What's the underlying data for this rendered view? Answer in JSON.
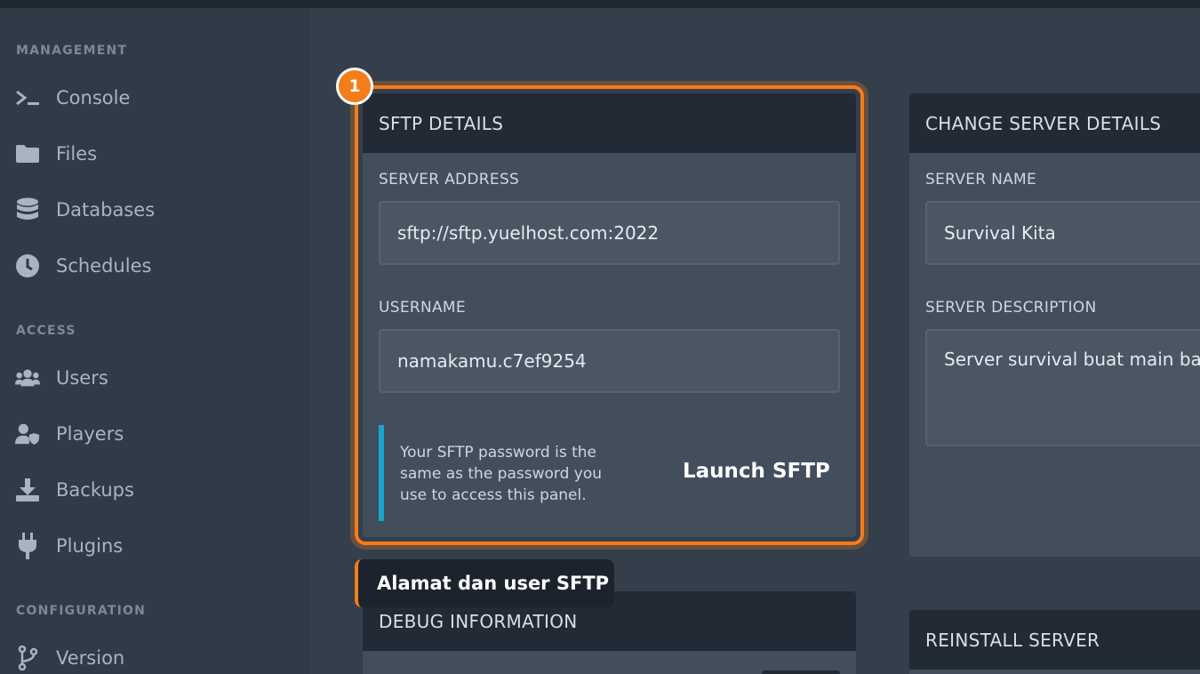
{
  "sidebar": {
    "sections": [
      {
        "label": "MANAGEMENT"
      },
      {
        "label": "ACCESS"
      },
      {
        "label": "CONFIGURATION"
      }
    ],
    "items": [
      {
        "label": "Console",
        "icon": "terminal-icon"
      },
      {
        "label": "Files",
        "icon": "folder-icon"
      },
      {
        "label": "Databases",
        "icon": "database-icon"
      },
      {
        "label": "Schedules",
        "icon": "clock-icon"
      },
      {
        "label": "Users",
        "icon": "users-icon"
      },
      {
        "label": "Players",
        "icon": "user-shield-icon"
      },
      {
        "label": "Backups",
        "icon": "download-icon"
      },
      {
        "label": "Plugins",
        "icon": "plug-icon"
      },
      {
        "label": "Version",
        "icon": "branch-icon"
      }
    ]
  },
  "sftp": {
    "title": "SFTP DETAILS",
    "address_label": "SERVER ADDRESS",
    "address_value": "sftp://sftp.yuelhost.com:2022",
    "username_label": "USERNAME",
    "username_value": "namakamu.c7ef9254",
    "note": "Your SFTP password is the same as the password you use to access this panel.",
    "launch_label": "Launch SFTP"
  },
  "change_server": {
    "title": "CHANGE SERVER DETAILS",
    "name_label": "SERVER NAME",
    "name_value": "Survival Kita",
    "description_label": "SERVER DESCRIPTION",
    "description_value": "Server survival buat main ba"
  },
  "debug": {
    "title": "DEBUG INFORMATION"
  },
  "reinstall": {
    "title": "REINSTALL SERVER"
  },
  "tutorial": {
    "step": "1",
    "tooltip": "Alamat dan user SFTP"
  },
  "colors": {
    "accent": "#f57c1a",
    "info": "#19a6cf",
    "header": "#212a35",
    "card": "#424e5c"
  }
}
